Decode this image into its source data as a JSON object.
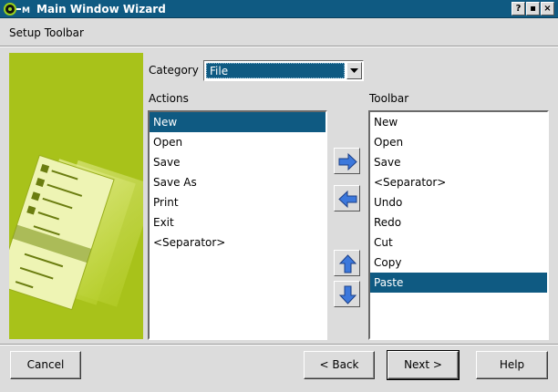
{
  "window": {
    "title": "Main Window Wizard",
    "buttons": {
      "help": "?",
      "maximize": "▪",
      "close": "×"
    }
  },
  "page": {
    "heading": "Setup Toolbar"
  },
  "category": {
    "label": "Category",
    "value": "File"
  },
  "actions": {
    "label": "Actions",
    "items": [
      {
        "label": "New",
        "selected": true
      },
      {
        "label": "Open",
        "selected": false
      },
      {
        "label": "Save",
        "selected": false
      },
      {
        "label": "Save As",
        "selected": false
      },
      {
        "label": "Print",
        "selected": false
      },
      {
        "label": "Exit",
        "selected": false
      },
      {
        "label": "<Separator>",
        "selected": false
      }
    ]
  },
  "toolbar": {
    "label": "Toolbar",
    "items": [
      {
        "label": "New",
        "selected": false
      },
      {
        "label": "Open",
        "selected": false
      },
      {
        "label": "Save",
        "selected": false
      },
      {
        "label": "<Separator>",
        "selected": false
      },
      {
        "label": "Undo",
        "selected": false
      },
      {
        "label": "Redo",
        "selected": false
      },
      {
        "label": "Cut",
        "selected": false
      },
      {
        "label": "Copy",
        "selected": false
      },
      {
        "label": "Paste",
        "selected": true
      }
    ]
  },
  "mover_icons": {
    "add": "arrow-right-icon",
    "remove": "arrow-left-icon",
    "up": "arrow-up-icon",
    "down": "arrow-down-icon"
  },
  "footer": {
    "cancel": "Cancel",
    "back": "< Back",
    "next": "Next >",
    "help": "Help"
  },
  "colors": {
    "title_bar": "#0f5a82",
    "selection": "#0f5a82",
    "sidebar": "#a8c21a",
    "arrow": "#3c78dc"
  }
}
